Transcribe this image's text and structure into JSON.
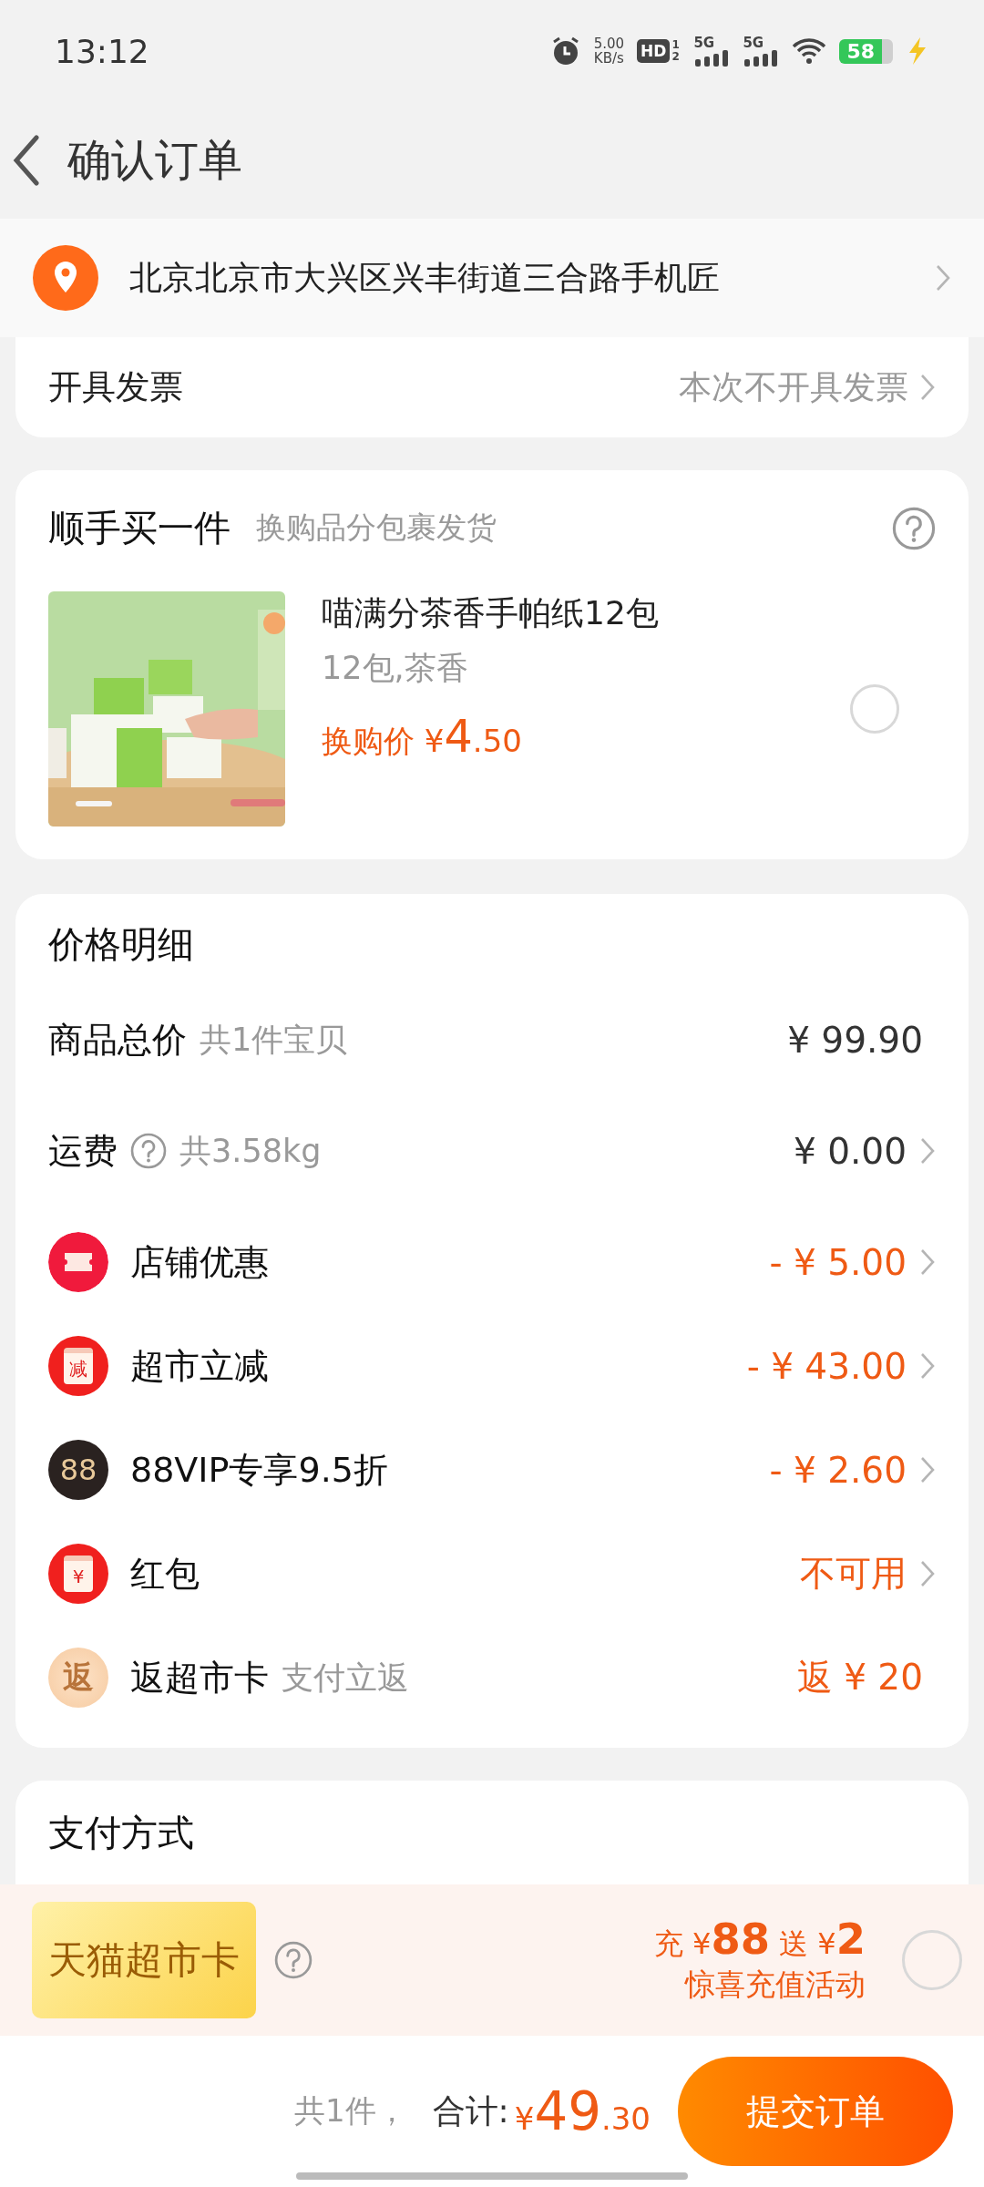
{
  "status_bar": {
    "time": "13:12",
    "net_speed": "5.00",
    "net_unit": "KB/s",
    "hd": "HD",
    "hd_sims": [
      "1",
      "2"
    ],
    "signals": [
      "5G",
      "5G"
    ],
    "battery": "58",
    "charging": true
  },
  "header": {
    "title": "确认订单"
  },
  "address": {
    "text": "北京北京市大兴区兴丰街道三合路手机匠"
  },
  "invoice": {
    "label": "开具发票",
    "value": "本次不开具发票"
  },
  "add_on": {
    "title": "顺手买一件",
    "subtitle": "换购品分包裹发货",
    "product": {
      "kind": "picture",
      "name": "喵满分茶香手帕纸12包",
      "spec": "12包,茶香",
      "price_label": "换购价",
      "currency": "¥",
      "price_int": "4",
      "price_dec": ".50",
      "selected": false
    }
  },
  "price_detail": {
    "title": "价格明细",
    "rows": [
      {
        "kind": "plain",
        "label": "商品总价",
        "note": "共1件宝贝",
        "value": "¥ 99.90",
        "chevron": false
      },
      {
        "kind": "help",
        "label": "运费",
        "note": "共3.58kg",
        "value": "¥ 0.00",
        "chevron": true
      },
      {
        "kind": "ticket",
        "label": "店铺优惠",
        "value": "- ¥ 5.00",
        "chevron": true
      },
      {
        "kind": "envelope",
        "icon_text": "减",
        "label": "超市立减",
        "value": "- ¥ 43.00",
        "chevron": true
      },
      {
        "kind": "vip",
        "icon_text": "88",
        "label": "88VIP专享9.5折",
        "value": "- ¥ 2.60",
        "chevron": true
      },
      {
        "kind": "envelope",
        "icon_text": "¥",
        "label": "红包",
        "value": "不可用",
        "chevron": true
      },
      {
        "kind": "return",
        "icon_text": "返",
        "label": "返超市卡",
        "note": "支付立返",
        "value": "返 ¥ 20",
        "chevron": false
      }
    ]
  },
  "payment": {
    "title": "支付方式"
  },
  "promo": {
    "card_name": "天猫超市卡",
    "recharge_label": "充",
    "recharge_currency": "¥",
    "recharge_amount": "88",
    "bonus_label": "送",
    "bonus_currency": "¥",
    "bonus_amount": "2",
    "caption": "惊喜充值活动",
    "selected": false
  },
  "footer": {
    "count": "共1件，",
    "total_label": "合计:",
    "currency": "¥",
    "total_int": "49",
    "total_dec": ".30",
    "submit": "提交订单"
  }
}
